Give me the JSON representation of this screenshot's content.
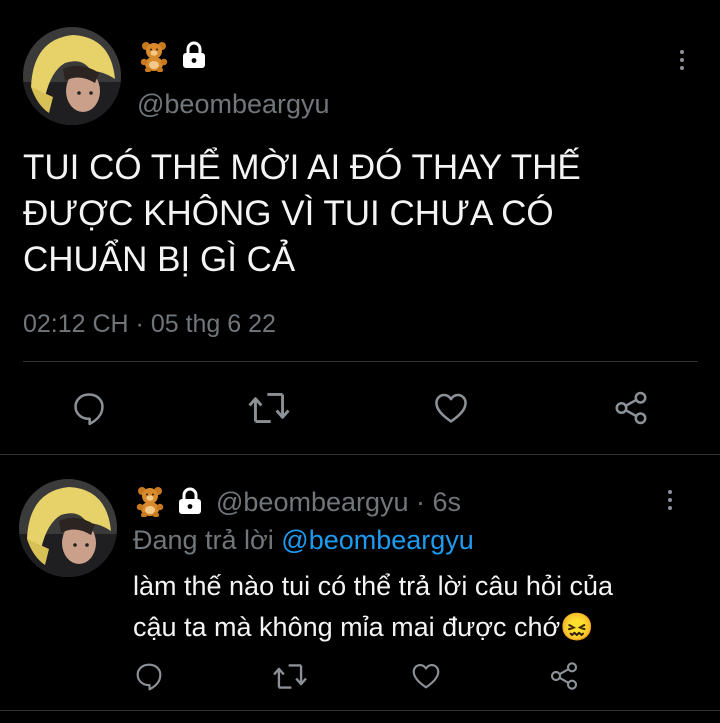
{
  "main_tweet": {
    "badges": [
      "teddy-bear",
      "lock"
    ],
    "handle": "@beombeargyu",
    "text_lines": [
      "TUI CÓ THỂ MỜI AI ĐÓ THAY THẾ",
      "ĐƯỢC KHÔNG VÌ TUI CHƯA CÓ",
      "CHUẨN BỊ GÌ CẢ"
    ],
    "timestamp": "02:12 CH · 05 thg 6 22",
    "actions": [
      "reply-icon",
      "retweet-icon",
      "like-icon",
      "share-icon"
    ]
  },
  "reply_tweet": {
    "handle": "@beombeargyu",
    "time": "· 6s",
    "replying_prefix": "Đang trả lời",
    "replying_to": "@beombeargyu",
    "text_lines": [
      "làm thế nào tui có thể trả lời câu hỏi của",
      "cậu ta mà không mỉa mai được chớ"
    ],
    "emoji": "😖",
    "actions": [
      "reply-icon",
      "retweet-icon",
      "like-icon",
      "share-icon"
    ]
  },
  "colors": {
    "background": "#000000",
    "text": "#e7e9ea",
    "secondary_text": "#71767b",
    "link": "#1d9bf0",
    "divider": "#2f3336"
  }
}
